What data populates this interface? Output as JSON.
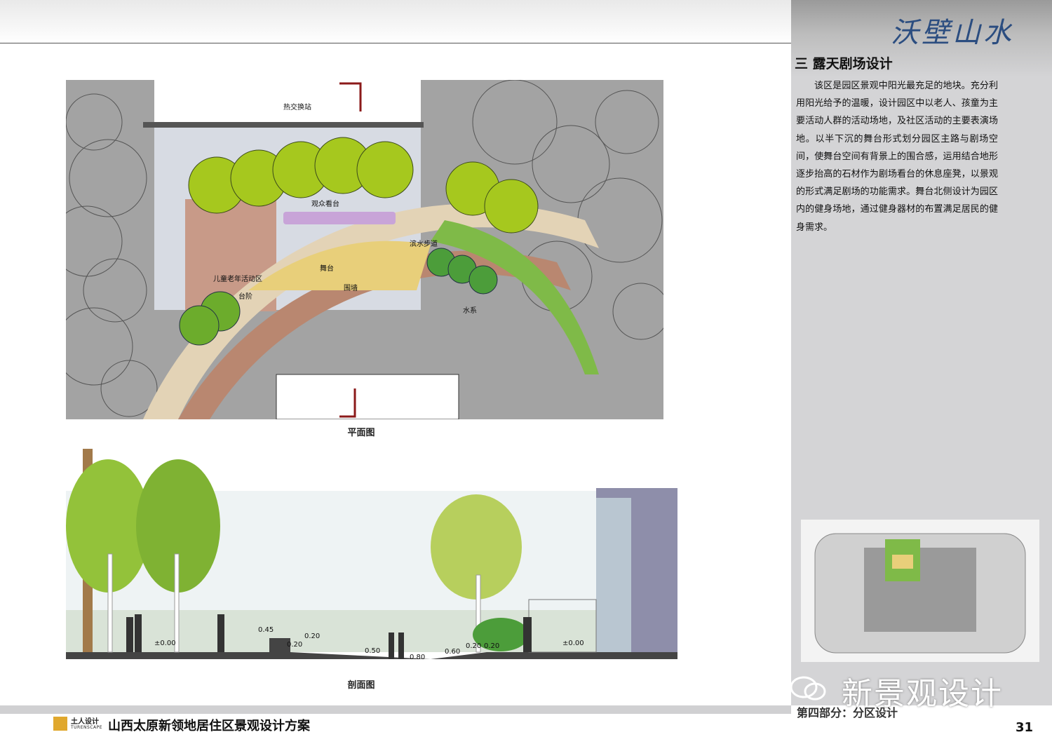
{
  "header": {
    "calligraphy": "沃壁山水"
  },
  "section": {
    "title": "三  露天剧场设计",
    "body": "该区是园区景观中阳光最充足的地块。充分利用阳光给予的温暖，设计园区中以老人、孩童为主要活动人群的活动场地，及社区活动的主要表演场地。以半下沉的舞台形式划分园区主路与剧场空间，使舞台空间有背景上的围合感，运用结合地形逐步抬高的石材作为剧场看台的休息座凳，以景观的形式满足剧场的功能需求。舞台北侧设计为园区内的健身场地，通过健身器材的布置满足居民的健身需求。"
  },
  "plan": {
    "caption": "平面图",
    "labels": {
      "heat_station": "热交换站",
      "audience": "观众看台",
      "waterfront": "滨水步道",
      "stage": "舞台",
      "kids_elderly": "儿童老年活动区",
      "steps": "台阶",
      "wall": "围墙",
      "water": "水系"
    }
  },
  "section_drawing": {
    "caption": "剖面图",
    "elevations": [
      "±0.00",
      "0.45",
      "0.20",
      "0.20",
      "0.50",
      "0.80",
      "0.60",
      "0.20",
      "0.20",
      "±0.00"
    ]
  },
  "watermark": "新景观设计",
  "footer": {
    "part": "第四部分：分区设计",
    "page": "31",
    "logo_cn": "土人设计",
    "logo_en": "TURENSCAPE",
    "project": "山西太原新领地居住区景观设计方案"
  },
  "colors": {
    "sidebar": "#d4d4d6",
    "tree_green": "#a6c81e",
    "stage_yellow": "#e8cf7a",
    "path_brown": "#b98770",
    "lawn_green": "#7fba48"
  }
}
